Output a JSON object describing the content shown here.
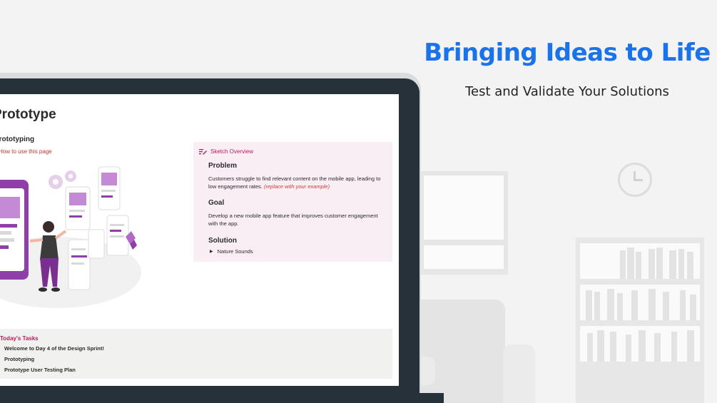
{
  "hero": {
    "headline": "Bringing Ideas to Life",
    "subheadline": "Test and Validate Your Solutions"
  },
  "page": {
    "title": "Prototype",
    "section_title": "Prototyping",
    "how_to_link": "How to use this page"
  },
  "callout": {
    "header": "Sketch Overview",
    "problem_title": "Problem",
    "problem_text": "Customers struggle to find relevant content on the mobile app, leading to low engagement rates.",
    "problem_hint": "(replace with your example)",
    "goal_title": "Goal",
    "goal_text": "Develop a new mobile app feature that improves customer engagement with the app.",
    "solution_title": "Solution",
    "solution_toggle": "Nature Sounds"
  },
  "tasks": {
    "title": "Today's Tasks",
    "items": [
      "Welcome to Day 4 of the Design Sprint!",
      "Prototyping",
      "Prototype User Testing Plan"
    ]
  },
  "colors": {
    "headline": "#1a73e8",
    "accent": "#c2185b",
    "laptop": "#27313a",
    "callout_bg": "#f9eef3",
    "illustration_purple": "#8e3fa8"
  }
}
